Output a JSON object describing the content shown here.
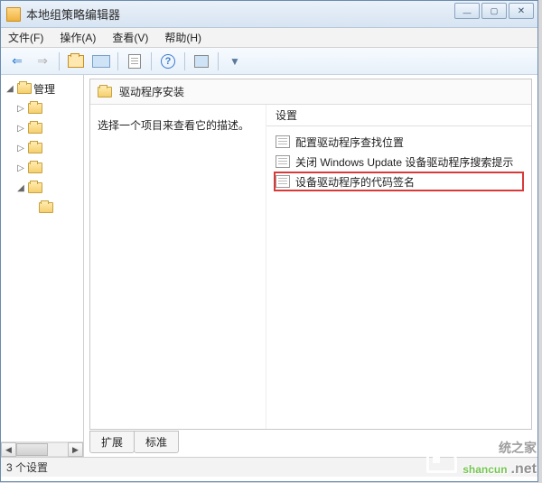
{
  "window": {
    "title": "本地组策略编辑器"
  },
  "menu": {
    "file": "文件(F)",
    "action": "操作(A)",
    "view": "查看(V)",
    "help": "帮助(H)"
  },
  "tree": {
    "root": "管理",
    "nodes": [
      "",
      "",
      "",
      "",
      "",
      ""
    ]
  },
  "right": {
    "header": "驱动程序安装",
    "description": "选择一个项目来查看它的描述。",
    "column": "设置",
    "items": [
      "配置驱动程序查找位置",
      "关闭 Windows Update 设备驱动程序搜索提示",
      "设备驱动程序的代码签名"
    ]
  },
  "tabs": {
    "extended": "扩展",
    "standard": "标准"
  },
  "status": "3 个设置",
  "watermark": {
    "text": "shancun",
    "suffix": ".net",
    "cn": "统之家"
  }
}
